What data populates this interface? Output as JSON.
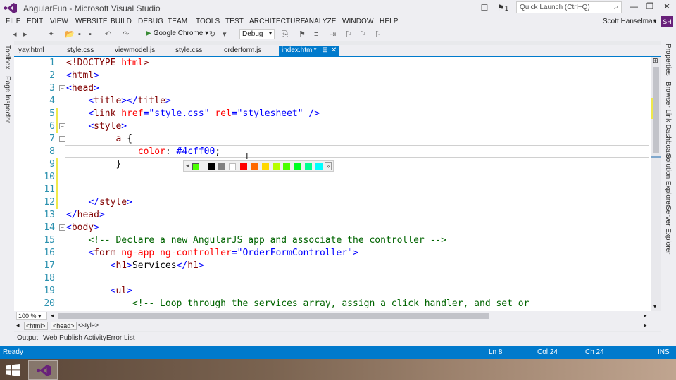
{
  "window": {
    "title": "AngularFun - Microsoft Visual Studio",
    "quick_launch_placeholder": "Quick Launch (Ctrl+Q)",
    "notification_count": "1",
    "user_name": "Scott Hanselman",
    "user_initials": "SH"
  },
  "menu": [
    "FILE",
    "EDIT",
    "VIEW",
    "WEBSITE",
    "BUILD",
    "DEBUG",
    "TEAM",
    "TOOLS",
    "TEST",
    "ARCHITECTURE",
    "ANALYZE",
    "WINDOW",
    "HELP"
  ],
  "toolbar": {
    "browser": "Google Chrome",
    "config": "Debug"
  },
  "left_tools": [
    "Toolbox",
    "Page Inspector"
  ],
  "right_tools": [
    "Properties",
    "Browser Link Dashboard",
    "Solution Explorer",
    "Server Explorer"
  ],
  "tabs": [
    "yay.html",
    "style.css",
    "viewmodel.js",
    "style.css",
    "orderform.js",
    "index.html*"
  ],
  "code_lines": [
    {
      "n": "1",
      "parts": [
        [
          "t",
          "<!DOCTYPE "
        ],
        [
          "a",
          "html"
        ],
        [
          "t",
          ">"
        ]
      ]
    },
    {
      "n": "2",
      "parts": [
        [
          "v",
          "<"
        ],
        [
          "t",
          "html"
        ],
        [
          "v",
          ">"
        ]
      ]
    },
    {
      "n": "3",
      "parts": [
        [
          "v",
          "<"
        ],
        [
          "t",
          "head"
        ],
        [
          "v",
          ">"
        ]
      ]
    },
    {
      "n": "4",
      "parts": [
        [
          "k",
          "    "
        ],
        [
          "v",
          "<"
        ],
        [
          "t",
          "title"
        ],
        [
          "v",
          "></"
        ],
        [
          "t",
          "title"
        ],
        [
          "v",
          ">"
        ]
      ]
    },
    {
      "n": "5",
      "parts": [
        [
          "k",
          "    "
        ],
        [
          "v",
          "<"
        ],
        [
          "t",
          "link "
        ],
        [
          "a",
          "href"
        ],
        [
          "v",
          "="
        ],
        [
          "v",
          "\"style.css\""
        ],
        [
          "k",
          " "
        ],
        [
          "a",
          "rel"
        ],
        [
          "v",
          "="
        ],
        [
          "v",
          "\"stylesheet\""
        ],
        [
          "k",
          " "
        ],
        [
          "v",
          "/>"
        ]
      ]
    },
    {
      "n": "6",
      "parts": [
        [
          "k",
          "    "
        ],
        [
          "v",
          "<"
        ],
        [
          "t",
          "style"
        ],
        [
          "v",
          ">"
        ]
      ]
    },
    {
      "n": "7",
      "parts": [
        [
          "k",
          "         "
        ],
        [
          "s",
          "a"
        ],
        [
          "k",
          " {"
        ]
      ]
    },
    {
      "n": "8",
      "parts": [
        [
          "k",
          "             "
        ],
        [
          "a",
          "color"
        ],
        [
          "k",
          ": "
        ],
        [
          "v",
          "#4cff00"
        ],
        [
          "k",
          ";"
        ]
      ]
    },
    {
      "n": "9",
      "parts": [
        [
          "k",
          "         }"
        ]
      ]
    },
    {
      "n": "10",
      "parts": []
    },
    {
      "n": "11",
      "parts": []
    },
    {
      "n": "12",
      "parts": [
        [
          "k",
          "    "
        ],
        [
          "v",
          "</"
        ],
        [
          "t",
          "style"
        ],
        [
          "v",
          ">"
        ]
      ]
    },
    {
      "n": "13",
      "parts": [
        [
          "v",
          "</"
        ],
        [
          "t",
          "head"
        ],
        [
          "v",
          ">"
        ]
      ]
    },
    {
      "n": "14",
      "parts": [
        [
          "v",
          "<"
        ],
        [
          "t",
          "body"
        ],
        [
          "v",
          ">"
        ]
      ]
    },
    {
      "n": "15",
      "parts": [
        [
          "k",
          "    "
        ],
        [
          "c",
          "<!-- Declare a new AngularJS app and associate the controller -->"
        ]
      ]
    },
    {
      "n": "16",
      "parts": [
        [
          "k",
          "    "
        ],
        [
          "v",
          "<"
        ],
        [
          "t",
          "form "
        ],
        [
          "a",
          "ng-app "
        ],
        [
          "a",
          "ng-controller"
        ],
        [
          "v",
          "="
        ],
        [
          "v",
          "\"OrderFormController\""
        ],
        [
          "v",
          ">"
        ]
      ]
    },
    {
      "n": "17",
      "parts": [
        [
          "k",
          "        "
        ],
        [
          "v",
          "<"
        ],
        [
          "t",
          "h1"
        ],
        [
          "v",
          ">"
        ],
        [
          "k",
          "Services"
        ],
        [
          "v",
          "</"
        ],
        [
          "t",
          "h1"
        ],
        [
          "v",
          ">"
        ]
      ]
    },
    {
      "n": "18",
      "parts": []
    },
    {
      "n": "19",
      "parts": [
        [
          "k",
          "        "
        ],
        [
          "v",
          "<"
        ],
        [
          "t",
          "ul"
        ],
        [
          "v",
          ">"
        ]
      ]
    },
    {
      "n": "20",
      "parts": [
        [
          "k",
          "            "
        ],
        [
          "c",
          "<!-- Loop through the services array, assign a click handler, and set or"
        ]
      ]
    }
  ],
  "color_swatches": [
    "#4cff00",
    "#000000",
    "#808080",
    "#ffffff",
    "#ff0000",
    "#ff6a00",
    "#ffd800",
    "#b6ff00",
    "#4cff00",
    "#00ff21",
    "#00ff90",
    "#00ffff"
  ],
  "zoom": "100 %",
  "breadcrumbs": [
    "<html>",
    "<head>",
    "<style>"
  ],
  "bottom_tabs": [
    "Output",
    "Web Publish Activity",
    "Error List"
  ],
  "status": {
    "left": "Ready",
    "ln": "Ln 8",
    "col": "Col 24",
    "ch": "Ch 24",
    "mode": "INS"
  }
}
